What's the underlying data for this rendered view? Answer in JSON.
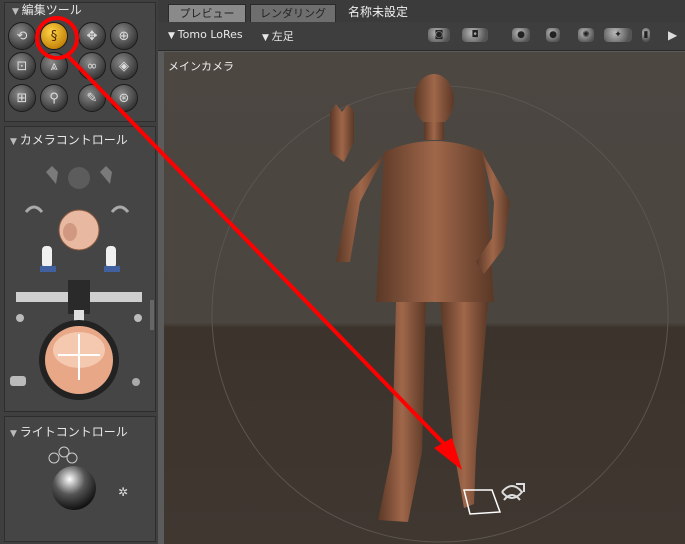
{
  "left_panel": {
    "edit_tools_title": "編集ツール",
    "camera_controls_title": "カメラコントロール",
    "light_controls_title": "ライトコントロール",
    "tools": [
      {
        "name": "rotate-tool-icon",
        "glyph": "⟲",
        "active": false
      },
      {
        "name": "twist-tool-icon",
        "glyph": "§",
        "active": true
      },
      {
        "name": "translate-tool-icon",
        "glyph": "✥",
        "active": false
      },
      {
        "name": "translate-in-out-tool-icon",
        "glyph": "⊕",
        "active": false
      },
      {
        "name": "scale-tool-icon",
        "glyph": "⊡",
        "active": false
      },
      {
        "name": "taper-tool-icon",
        "glyph": "⩓",
        "active": false
      },
      {
        "name": "chain-break-tool-icon",
        "glyph": "∞",
        "active": false
      },
      {
        "name": "color-tool-icon",
        "glyph": "◈",
        "active": false
      },
      {
        "name": "grouping-tool-icon",
        "glyph": "⊞",
        "active": false
      },
      {
        "name": "view-magnifier-tool-icon",
        "glyph": "⚲",
        "active": false
      },
      {
        "name": "morph-brush-tool-icon",
        "glyph": "✎",
        "active": false
      },
      {
        "name": "direct-manipulation-tool-icon",
        "glyph": "⊛",
        "active": false
      }
    ]
  },
  "tabs": {
    "preview": "プレビュー",
    "render": "レンダリング"
  },
  "document_title": "名称未設定",
  "toolbar": {
    "figure_select": "Tomo LoRes",
    "part_select": "左足"
  },
  "viewport": {
    "camera_label": "メインカメラ"
  },
  "colors": {
    "annotation": "#ff0000",
    "active_tool": "#e0a010",
    "figure_skin": "#8a5a40"
  }
}
